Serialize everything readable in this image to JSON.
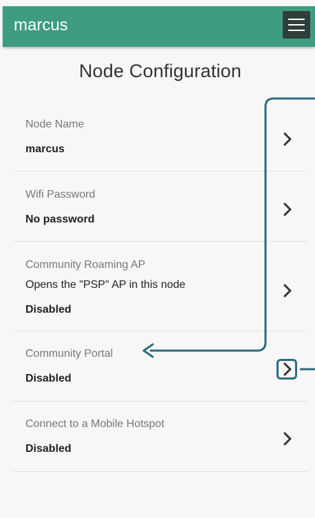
{
  "app": {
    "title": "marcus"
  },
  "page": {
    "title": "Node Configuration"
  },
  "settings": [
    {
      "label": "Node Name",
      "value": "marcus"
    },
    {
      "label": "Wifi Password",
      "value": "No password"
    },
    {
      "label": "Community Roaming AP",
      "description": "Opens the \"PSP\" AP in this node",
      "value": "Disabled"
    },
    {
      "label": "Community Portal",
      "value": "Disabled"
    },
    {
      "label": "Connect to a Mobile Hotspot",
      "value": "Disabled"
    }
  ],
  "icons": {
    "menu": "hamburger-menu-icon",
    "chevron": "chevron-right-icon",
    "annotation": "arrow-left-icon"
  },
  "colors": {
    "appbar": "#3e9c81",
    "menu_button": "#2e3f3a",
    "annotation": "#2b6b7c",
    "background": "#f7f7f7"
  }
}
